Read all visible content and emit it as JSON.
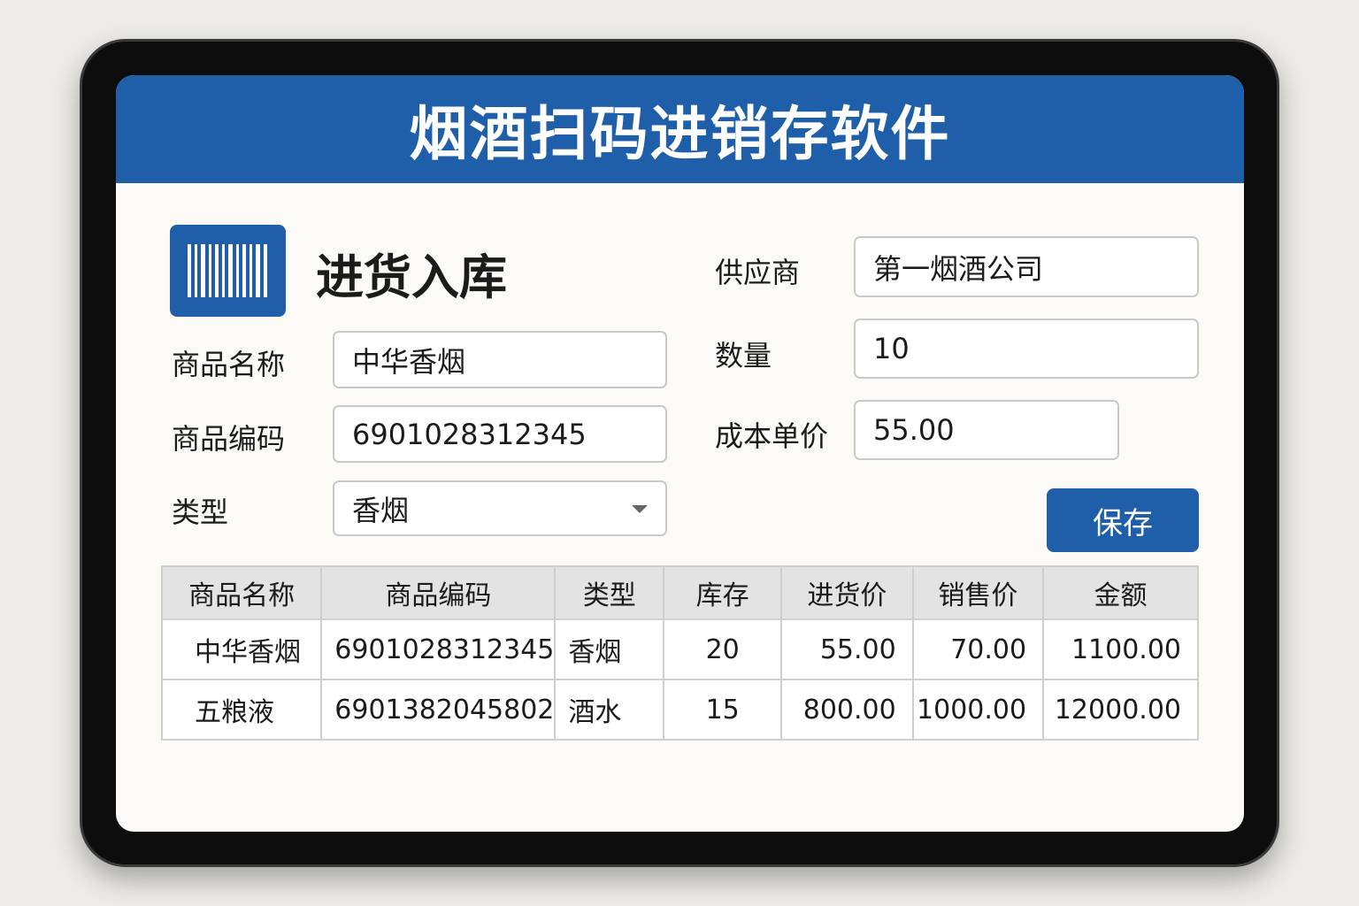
{
  "app_title": "烟酒扫码进销存软件",
  "section_title": "进货入库",
  "form": {
    "product_name": {
      "label": "商品名称",
      "value": "中华香烟"
    },
    "product_code": {
      "label": "商品编码",
      "value": "6901028312345"
    },
    "category": {
      "label": "类型",
      "value": "香烟"
    },
    "supplier": {
      "label": "供应商",
      "value": "第一烟酒公司"
    },
    "quantity": {
      "label": "数量",
      "value": "10"
    },
    "unit_cost": {
      "label": "成本单价",
      "value": "55.00"
    },
    "save_label": "保存"
  },
  "table": {
    "headers": [
      "商品名称",
      "商品编码",
      "类型",
      "库存",
      "进货价",
      "销售价",
      "金额"
    ],
    "rows": [
      [
        "中华香烟",
        "6901028312345",
        "香烟",
        "20",
        "55.00",
        "70.00",
        "1100.00"
      ],
      [
        "五粮液",
        "6901382045802",
        "酒水",
        "15",
        "800.00",
        "1000.00",
        "12000.00"
      ]
    ]
  },
  "colors": {
    "primary": "#1f5fa9"
  }
}
